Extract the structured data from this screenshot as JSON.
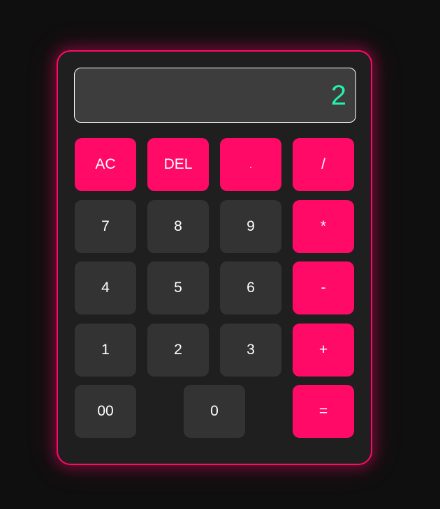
{
  "display": {
    "value": "2"
  },
  "buttons": {
    "ac": "AC",
    "del": "DEL",
    "dot": ".",
    "divide": "/",
    "seven": "7",
    "eight": "8",
    "nine": "9",
    "multiply": "*",
    "four": "4",
    "five": "5",
    "six": "6",
    "subtract": "-",
    "one": "1",
    "two": "2",
    "three": "3",
    "add": "+",
    "double_zero": "00",
    "zero": "0",
    "equals": "="
  },
  "colors": {
    "background": "#0f0f0f",
    "body": "#1f1f1f",
    "accent": "#ff0a67",
    "key": "#333333",
    "display_bg": "#3d3d3d",
    "display_text": "#25efb0"
  }
}
